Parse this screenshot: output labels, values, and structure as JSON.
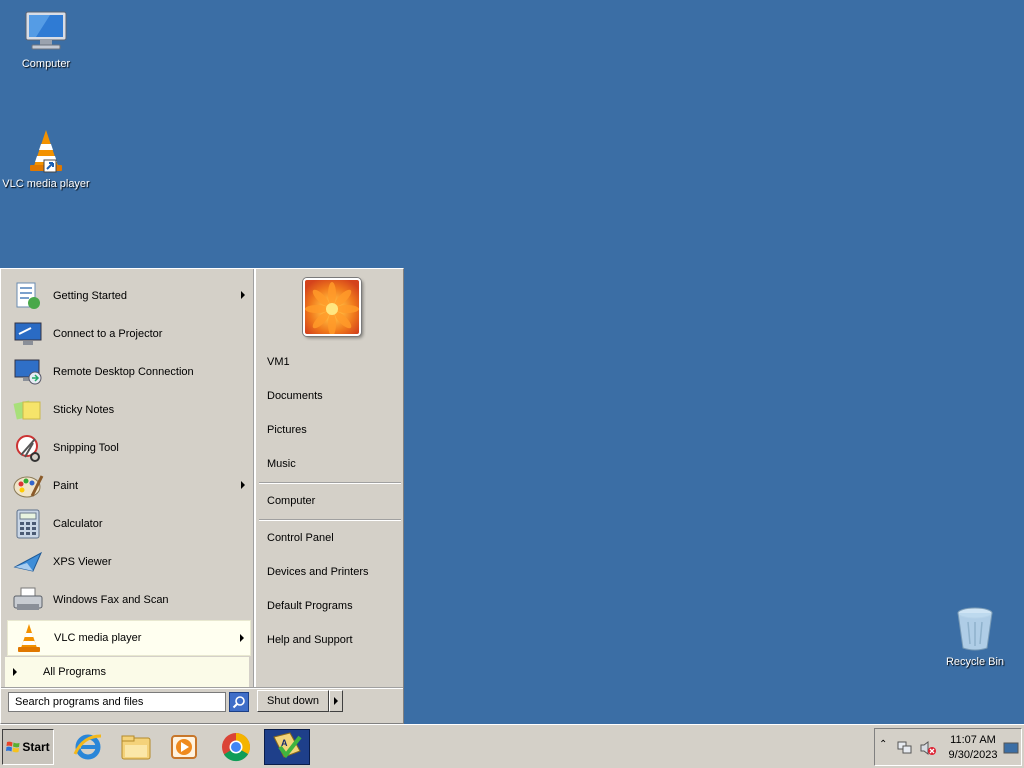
{
  "desktop": {
    "icons": [
      {
        "label": "Computer",
        "icon": "computer-icon"
      },
      {
        "label": "VLC media player",
        "icon": "vlc-icon"
      },
      {
        "label": "Recycle Bin",
        "icon": "recycle-bin-icon"
      }
    ]
  },
  "start_menu": {
    "programs": [
      {
        "label": "Getting Started",
        "icon": "getting-started-icon",
        "submenu": true
      },
      {
        "label": "Connect to a Projector",
        "icon": "projector-icon",
        "submenu": false
      },
      {
        "label": "Remote Desktop Connection",
        "icon": "remote-desktop-icon",
        "submenu": false
      },
      {
        "label": "Sticky Notes",
        "icon": "sticky-notes-icon",
        "submenu": false
      },
      {
        "label": "Snipping Tool",
        "icon": "snipping-tool-icon",
        "submenu": false
      },
      {
        "label": "Paint",
        "icon": "paint-icon",
        "submenu": true
      },
      {
        "label": "Calculator",
        "icon": "calculator-icon",
        "submenu": false
      },
      {
        "label": "XPS Viewer",
        "icon": "xps-viewer-icon",
        "submenu": false
      },
      {
        "label": "Windows Fax and Scan",
        "icon": "fax-scan-icon",
        "submenu": false
      },
      {
        "label": "VLC media player",
        "icon": "vlc-icon",
        "submenu": true,
        "highlighted": true
      }
    ],
    "all_programs": "All Programs",
    "search_placeholder": "Search programs and files",
    "right_items": {
      "user": "VM1",
      "documents": "Documents",
      "pictures": "Pictures",
      "music": "Music",
      "computer": "Computer",
      "control_panel": "Control Panel",
      "devices_printers": "Devices and Printers",
      "default_programs": "Default Programs",
      "help_support": "Help and Support"
    },
    "shutdown_label": "Shut down"
  },
  "taskbar": {
    "start_label": "Start",
    "pinned": [
      "internet-explorer-icon",
      "windows-explorer-icon",
      "media-player-icon",
      "chrome-icon",
      "active-app-icon"
    ],
    "clock": {
      "time": "11:07 AM",
      "date": "9/30/2023"
    }
  },
  "colors": {
    "desktop": "#3b6ea5",
    "menu": "#d4d0c8",
    "highlight": "#fffff0"
  }
}
